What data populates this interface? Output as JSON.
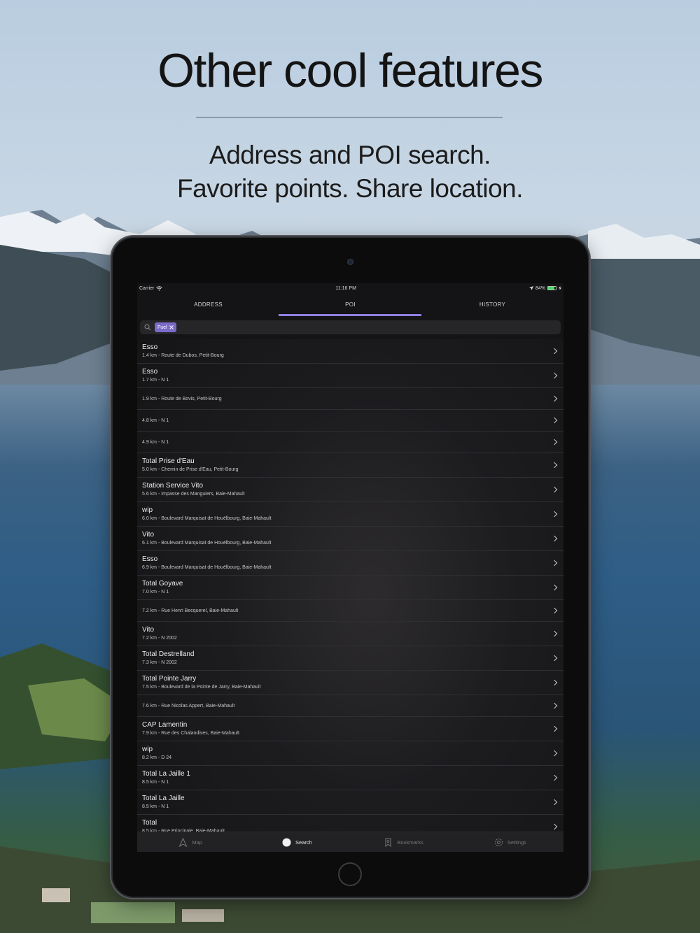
{
  "promo": {
    "headline": "Other cool features",
    "subline_1": "Address and POI search.",
    "subline_2": "Favorite points. Share location."
  },
  "status": {
    "carrier": "Carrier",
    "time": "11:16 PM",
    "battery": "84%",
    "battery_level": 0.84
  },
  "tabs": [
    {
      "label": "ADDRESS"
    },
    {
      "label": "POI",
      "active": true
    },
    {
      "label": "HISTORY"
    }
  ],
  "search": {
    "token": "Fuel"
  },
  "results": [
    {
      "title": "Esso",
      "sub": "1.4 km - Route de Dubos, Petit-Bourg"
    },
    {
      "title": "Esso",
      "sub": "1.7 km - N 1"
    },
    {
      "title": "",
      "sub": "1.9 km - Route de Bovis, Petit-Bourg"
    },
    {
      "title": "",
      "sub": "4.8 km - N 1"
    },
    {
      "title": "",
      "sub": "4.9 km - N 1"
    },
    {
      "title": "Total Prise d'Eau",
      "sub": "5.0 km - Chemin de Prise d'Eau, Petit-Bourg"
    },
    {
      "title": "Station Service Vito",
      "sub": "5.6 km - Impasse des Manguiers, Baie-Mahault"
    },
    {
      "title": "wip",
      "sub": "6.0 km - Boulevard Marquisat de Houëlbourg, Baie-Mahault"
    },
    {
      "title": "Vito",
      "sub": "6.1 km - Boulevard Marquisat de Houëlbourg, Baie-Mahault"
    },
    {
      "title": "Esso",
      "sub": "6.9 km - Boulevard Marquisat de Houëlbourg, Baie-Mahault"
    },
    {
      "title": "Total Goyave",
      "sub": "7.0 km - N 1"
    },
    {
      "title": "",
      "sub": "7.2 km - Rue Henri Becquerel, Baie-Mahault"
    },
    {
      "title": "Vito",
      "sub": "7.2 km - N 2002"
    },
    {
      "title": "Total Destrelland",
      "sub": "7.3 km - N 2002"
    },
    {
      "title": "Total Pointe Jarry",
      "sub": "7.5 km - Boulevard de la Pointe de Jarry, Baie-Mahault"
    },
    {
      "title": "",
      "sub": "7.6 km - Rue Nicolas Appert, Baie-Mahault"
    },
    {
      "title": "CAP Lamentin",
      "sub": "7.9 km - Rue des Chalandises, Baie-Mahault"
    },
    {
      "title": "wip",
      "sub": "8.2 km - D 24"
    },
    {
      "title": "Total La Jaille 1",
      "sub": "8.5 km - N 1"
    },
    {
      "title": "Total La Jaille",
      "sub": "8.5 km - N 1"
    },
    {
      "title": "Total",
      "sub": "8.5 km - Rue Principale, Baie-Mahault"
    }
  ],
  "bottom_tabs": [
    {
      "label": "Map",
      "icon": "navigation-arrow-icon"
    },
    {
      "label": "Search",
      "icon": "search-icon",
      "active": true
    },
    {
      "label": "Bookmarks",
      "icon": "bookmark-icon"
    },
    {
      "label": "Settings",
      "icon": "gear-icon"
    }
  ],
  "colors": {
    "accent": "#8f7fe0",
    "token_bg": "#7b6ac8",
    "battery": "#4cd964"
  }
}
